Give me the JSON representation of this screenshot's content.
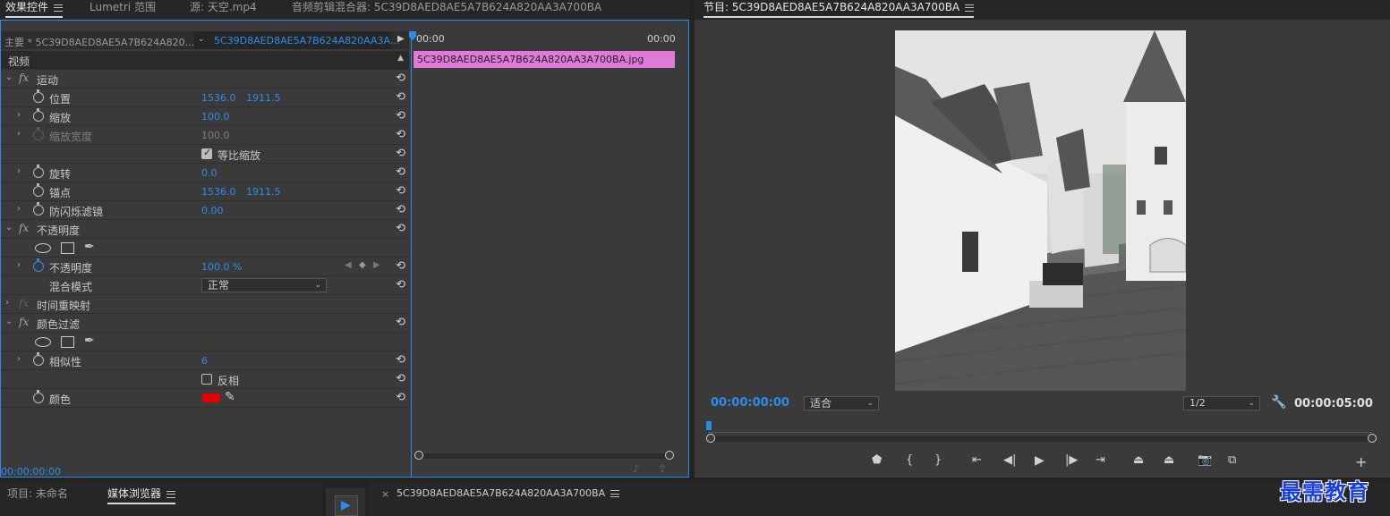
{
  "top_tabs": [
    {
      "label": "效果控件",
      "active": true
    },
    {
      "label": "Lumetri 范围",
      "active": false
    },
    {
      "label": "源: 天空.mp4",
      "active": false
    },
    {
      "label": "音频剪辑混合器: 5C39D8AED8AE5A7B624A820AA3A700BA",
      "active": false
    }
  ],
  "program_tab": {
    "label": "节目: 5C39D8AED8AE5A7B624A820AA3A700BA"
  },
  "effect_controls": {
    "master_clip": "主要 * 5C39D8AED8AE5A7B624A820...",
    "sequence_clip": "5C39D8AED8AE5A7B624A820AA3A...",
    "section_video": "视频",
    "rows": {
      "motion": "运动",
      "position": {
        "label": "位置",
        "x": "1536.0",
        "y": "1911.5"
      },
      "scale": {
        "label": "缩放",
        "value": "100.0"
      },
      "scale_width": {
        "label": "缩放宽度",
        "value": "100.0"
      },
      "uniform_scale": {
        "label": "等比缩放",
        "checked": true
      },
      "rotation": {
        "label": "旋转",
        "value": "0.0"
      },
      "anchor": {
        "label": "锚点",
        "x": "1536.0",
        "y": "1911.5"
      },
      "anti_flicker": {
        "label": "防闪烁滤镜",
        "value": "0.00"
      },
      "opacity_group": "不透明度",
      "opacity": {
        "label": "不透明度",
        "value": "100.0 %"
      },
      "blend_mode": {
        "label": "混合模式",
        "value": "正常"
      },
      "time_remap": "时间重映射",
      "color_key": "颜色过滤",
      "similarity": {
        "label": "相似性",
        "value": "6"
      },
      "invert": {
        "label": "反相",
        "checked": false
      },
      "color": {
        "label": "颜色",
        "swatch": "#e00000"
      }
    },
    "timeline": {
      "start": "00:00",
      "end": "00:00",
      "clip": "5C39D8AED8AE5A7B624A820AA3A700BA.jpg",
      "clip_color": "#e07ad8"
    },
    "footer_timecode": "00:00:00:00"
  },
  "program_monitor": {
    "current_time": "00:00:00:00",
    "fit": "适合",
    "resolution": "1/2",
    "duration": "00:00:05:00"
  },
  "bottom": {
    "project_tab": "项目: 未命名",
    "media_browser_tab": "媒体浏览器",
    "timeline_tab": "5C39D8AED8AE5A7B624A820AA3A700BA",
    "timeline_close": "×",
    "watermark": "最需教育"
  },
  "colors": {
    "accent": "#2d8ceb",
    "clip": "#e07ad8",
    "panel": "#3a3a3a",
    "chrome": "#232323"
  }
}
